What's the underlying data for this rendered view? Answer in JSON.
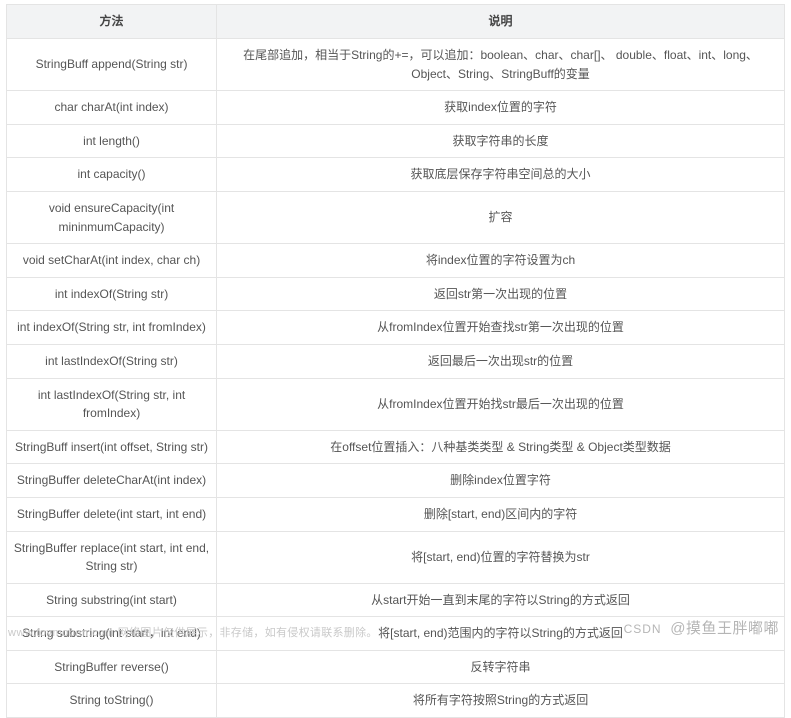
{
  "table": {
    "headers": [
      "方法",
      "说明"
    ],
    "rows": [
      {
        "method": "StringBuff append(String str)",
        "desc": "在尾部追加，相当于String的+=，可以追加：boolean、char、char[]、 double、float、int、long、Object、String、StringBuff的变量"
      },
      {
        "method": "char charAt(int index)",
        "desc": "获取index位置的字符"
      },
      {
        "method": "int length()",
        "desc": "获取字符串的长度"
      },
      {
        "method": "int capacity()",
        "desc": "获取底层保存字符串空间总的大小"
      },
      {
        "method": "void ensureCapacity(int mininmumCapacity)",
        "desc": "扩容"
      },
      {
        "method": "void setCharAt(int index, char ch)",
        "desc": "将index位置的字符设置为ch"
      },
      {
        "method": "int indexOf(String str)",
        "desc": "返回str第一次出现的位置"
      },
      {
        "method": "int indexOf(String str, int fromIndex)",
        "desc": "从fromIndex位置开始查找str第一次出现的位置"
      },
      {
        "method": "int lastIndexOf(String str)",
        "desc": "返回最后一次出现str的位置"
      },
      {
        "method": "int lastIndexOf(String str, int fromIndex)",
        "desc": "从fromIndex位置开始找str最后一次出现的位置"
      },
      {
        "method": "StringBuff insert(int offset, String str)",
        "desc": "在offset位置插入：八种基类类型 & String类型 & Object类型数据"
      },
      {
        "method": "StringBuffer deleteCharAt(int index)",
        "desc": "删除index位置字符"
      },
      {
        "method": "StringBuffer delete(int start, int end)",
        "desc": "删除[start, end)区间内的字符"
      },
      {
        "method": "StringBuffer replace(int start, int end, String str)",
        "desc": "将[start, end)位置的字符替换为str"
      },
      {
        "method": "String substring(int start)",
        "desc": "从start开始一直到末尾的字符以String的方式返回"
      },
      {
        "method": "String substring(int start，int end)",
        "desc": "将[start, end)范围内的字符以String的方式返回"
      },
      {
        "method": "StringBuffer reverse()",
        "desc": "反转字符串"
      },
      {
        "method": "String toString()",
        "desc": "将所有字符按照String的方式返回"
      }
    ]
  },
  "footer": {
    "domain": "www.toymoban.com",
    "note": "网络图片仅供展示，非存储，如有侵权请联系删除。"
  },
  "watermark": {
    "prefix": "CSDN",
    "name": "@摸鱼王胖嘟嘟"
  }
}
